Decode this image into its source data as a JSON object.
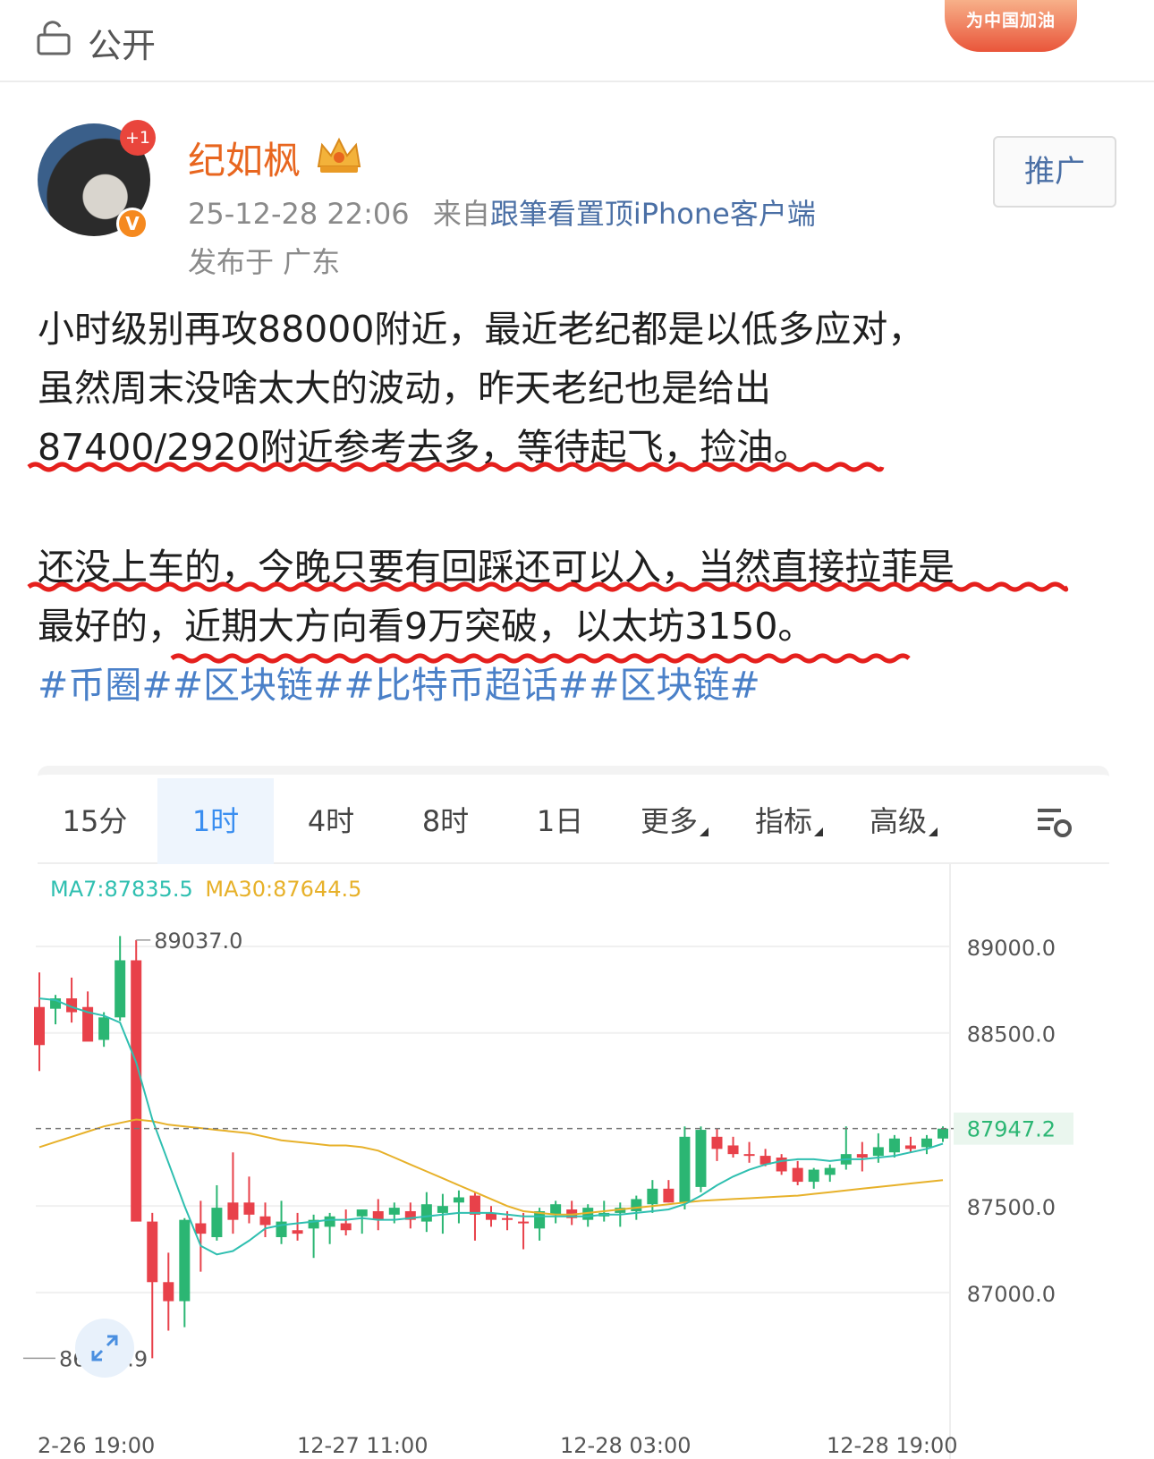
{
  "header": {
    "visibility_label": "公开",
    "badge_text": "为中国加油"
  },
  "post": {
    "author": "纪如枫",
    "plus_badge": "+1",
    "verified_mark": "V",
    "timestamp": "25-12-28 22:06",
    "source_prefix": "来自",
    "source_name": "跟筆看置顶iPhone客户端",
    "location": "发布于 广东",
    "promote_label": "推广",
    "text_lines": [
      "小时级别再攻88000附近，最近老纪都是以低多应对，",
      "虽然周末没啥太大的波动，昨天老纪也是给出",
      "87400/2920附近参考去多，等待起飞，捡油。",
      "还没上车的，今晚只要有回踩还可以入，当然直接拉菲是",
      "最好的，近期大方向看9万突破，以太坊3150。"
    ],
    "tags": "#币圈##区块链##比特币超话##区块链#"
  },
  "chart_tabs": [
    {
      "label": "15分",
      "active": false
    },
    {
      "label": "1时",
      "active": true
    },
    {
      "label": "4时",
      "active": false
    },
    {
      "label": "8时",
      "active": false
    },
    {
      "label": "1日",
      "active": false
    },
    {
      "label": "更多",
      "active": false,
      "dropdown": true
    },
    {
      "label": "指标",
      "active": false,
      "dropdown": true
    },
    {
      "label": "高级",
      "active": false,
      "dropdown": true
    }
  ],
  "chart_settings_icon": "chart-settings-icon",
  "colors": {
    "up": "#2bb673",
    "down": "#e8414a",
    "ma7": "#2fbfb0",
    "ma30": "#e7b12a",
    "link": "#4a80c8",
    "author": "#e8661f"
  },
  "chart_data": {
    "type": "candlestick",
    "ma7_label": "MA7:87835.5",
    "ma30_label": "MA30:87644.5",
    "y_ticks": [
      "89000.0",
      "88500.0",
      "87500.0",
      "87000.0"
    ],
    "y_tick_values": [
      89000,
      88500,
      87500,
      87000
    ],
    "last_price_label": "87947.2",
    "last_price": 87947.2,
    "ylim": [
      86560,
      89300
    ],
    "high_label": "89037.0",
    "high_value": 89037.0,
    "low_label": "86619.9",
    "low_value": 86619.9,
    "x_ticks": [
      "2-26 19:00",
      "12-27 11:00",
      "12-28 03:00",
      "12-28 19:00"
    ],
    "candles": [
      [
        88650,
        88850,
        88280,
        88430
      ],
      [
        88640,
        88720,
        88550,
        88700
      ],
      [
        88700,
        88820,
        88560,
        88620
      ],
      [
        88650,
        88740,
        88460,
        88450
      ],
      [
        88460,
        88620,
        88420,
        88590
      ],
      [
        88590,
        89060,
        88570,
        88920
      ],
      [
        88920,
        89037,
        87460,
        87410
      ],
      [
        87410,
        87460,
        86620,
        87060
      ],
      [
        87060,
        87230,
        86780,
        86950
      ],
      [
        86950,
        87430,
        86800,
        87420
      ],
      [
        87400,
        87530,
        87120,
        87340
      ],
      [
        87320,
        87620,
        87300,
        87490
      ],
      [
        87520,
        87810,
        87340,
        87420
      ],
      [
        87520,
        87670,
        87400,
        87450
      ],
      [
        87440,
        87520,
        87320,
        87390
      ],
      [
        87320,
        87530,
        87280,
        87410
      ],
      [
        87360,
        87460,
        87300,
        87340
      ],
      [
        87370,
        87450,
        87200,
        87420
      ],
      [
        87380,
        87460,
        87280,
        87440
      ],
      [
        87400,
        87480,
        87330,
        87360
      ],
      [
        87440,
        87480,
        87340,
        87480
      ],
      [
        87470,
        87540,
        87360,
        87420
      ],
      [
        87450,
        87520,
        87400,
        87490
      ],
      [
        87470,
        87520,
        87370,
        87420
      ],
      [
        87410,
        87580,
        87350,
        87510
      ],
      [
        87460,
        87570,
        87340,
        87500
      ],
      [
        87520,
        87590,
        87400,
        87550
      ],
      [
        87560,
        87580,
        87300,
        87450
      ],
      [
        87460,
        87500,
        87380,
        87420
      ],
      [
        87430,
        87470,
        87360,
        87420
      ],
      [
        87410,
        87460,
        87250,
        87400
      ],
      [
        87370,
        87490,
        87300,
        87470
      ],
      [
        87450,
        87530,
        87400,
        87510
      ],
      [
        87480,
        87530,
        87390,
        87430
      ],
      [
        87420,
        87510,
        87380,
        87490
      ],
      [
        87440,
        87530,
        87410,
        87460
      ],
      [
        87460,
        87520,
        87380,
        87490
      ],
      [
        87470,
        87560,
        87420,
        87540
      ],
      [
        87510,
        87650,
        87460,
        87600
      ],
      [
        87600,
        87650,
        87520,
        87520
      ],
      [
        87520,
        87960,
        87480,
        87900
      ],
      [
        87610,
        87960,
        87580,
        87940
      ],
      [
        87900,
        87950,
        87760,
        87830
      ],
      [
        87850,
        87900,
        87780,
        87800
      ],
      [
        87800,
        87870,
        87750,
        87790
      ],
      [
        87790,
        87830,
        87730,
        87740
      ],
      [
        87780,
        87800,
        87680,
        87700
      ],
      [
        87720,
        87760,
        87620,
        87640
      ],
      [
        87640,
        87720,
        87600,
        87710
      ],
      [
        87680,
        87740,
        87640,
        87720
      ],
      [
        87740,
        87960,
        87710,
        87800
      ],
      [
        87800,
        87870,
        87700,
        87780
      ],
      [
        87790,
        87920,
        87750,
        87840
      ],
      [
        87810,
        87910,
        87780,
        87890
      ],
      [
        87850,
        87900,
        87810,
        87830
      ],
      [
        87840,
        87910,
        87800,
        87890
      ],
      [
        87890,
        87960,
        87870,
        87947.2
      ]
    ],
    "ma7": [
      88700,
      88690,
      88650,
      88620,
      88600,
      88560,
      88330,
      88000,
      87750,
      87500,
      87270,
      87220,
      87240,
      87300,
      87370,
      87390,
      87400,
      87410,
      87420,
      87420,
      87430,
      87420,
      87420,
      87430,
      87440,
      87450,
      87460,
      87460,
      87460,
      87450,
      87440,
      87440,
      87440,
      87440,
      87440,
      87450,
      87450,
      87460,
      87470,
      87480,
      87510,
      87560,
      87620,
      87670,
      87710,
      87740,
      87760,
      87770,
      87770,
      87760,
      87770,
      87770,
      87780,
      87790,
      87810,
      87830,
      87860
    ],
    "ma30": [
      87840,
      87870,
      87900,
      87930,
      87960,
      87980,
      88000,
      87990,
      87970,
      87960,
      87950,
      87940,
      87930,
      87920,
      87900,
      87880,
      87870,
      87860,
      87850,
      87850,
      87840,
      87820,
      87780,
      87740,
      87700,
      87660,
      87620,
      87580,
      87540,
      87500,
      87470,
      87460,
      87450,
      87450,
      87460,
      87470,
      87480,
      87490,
      87500,
      87510,
      87520,
      87530,
      87535,
      87540,
      87545,
      87550,
      87555,
      87560,
      87570,
      87580,
      87590,
      87600,
      87610,
      87620,
      87630,
      87640,
      87650
    ]
  }
}
